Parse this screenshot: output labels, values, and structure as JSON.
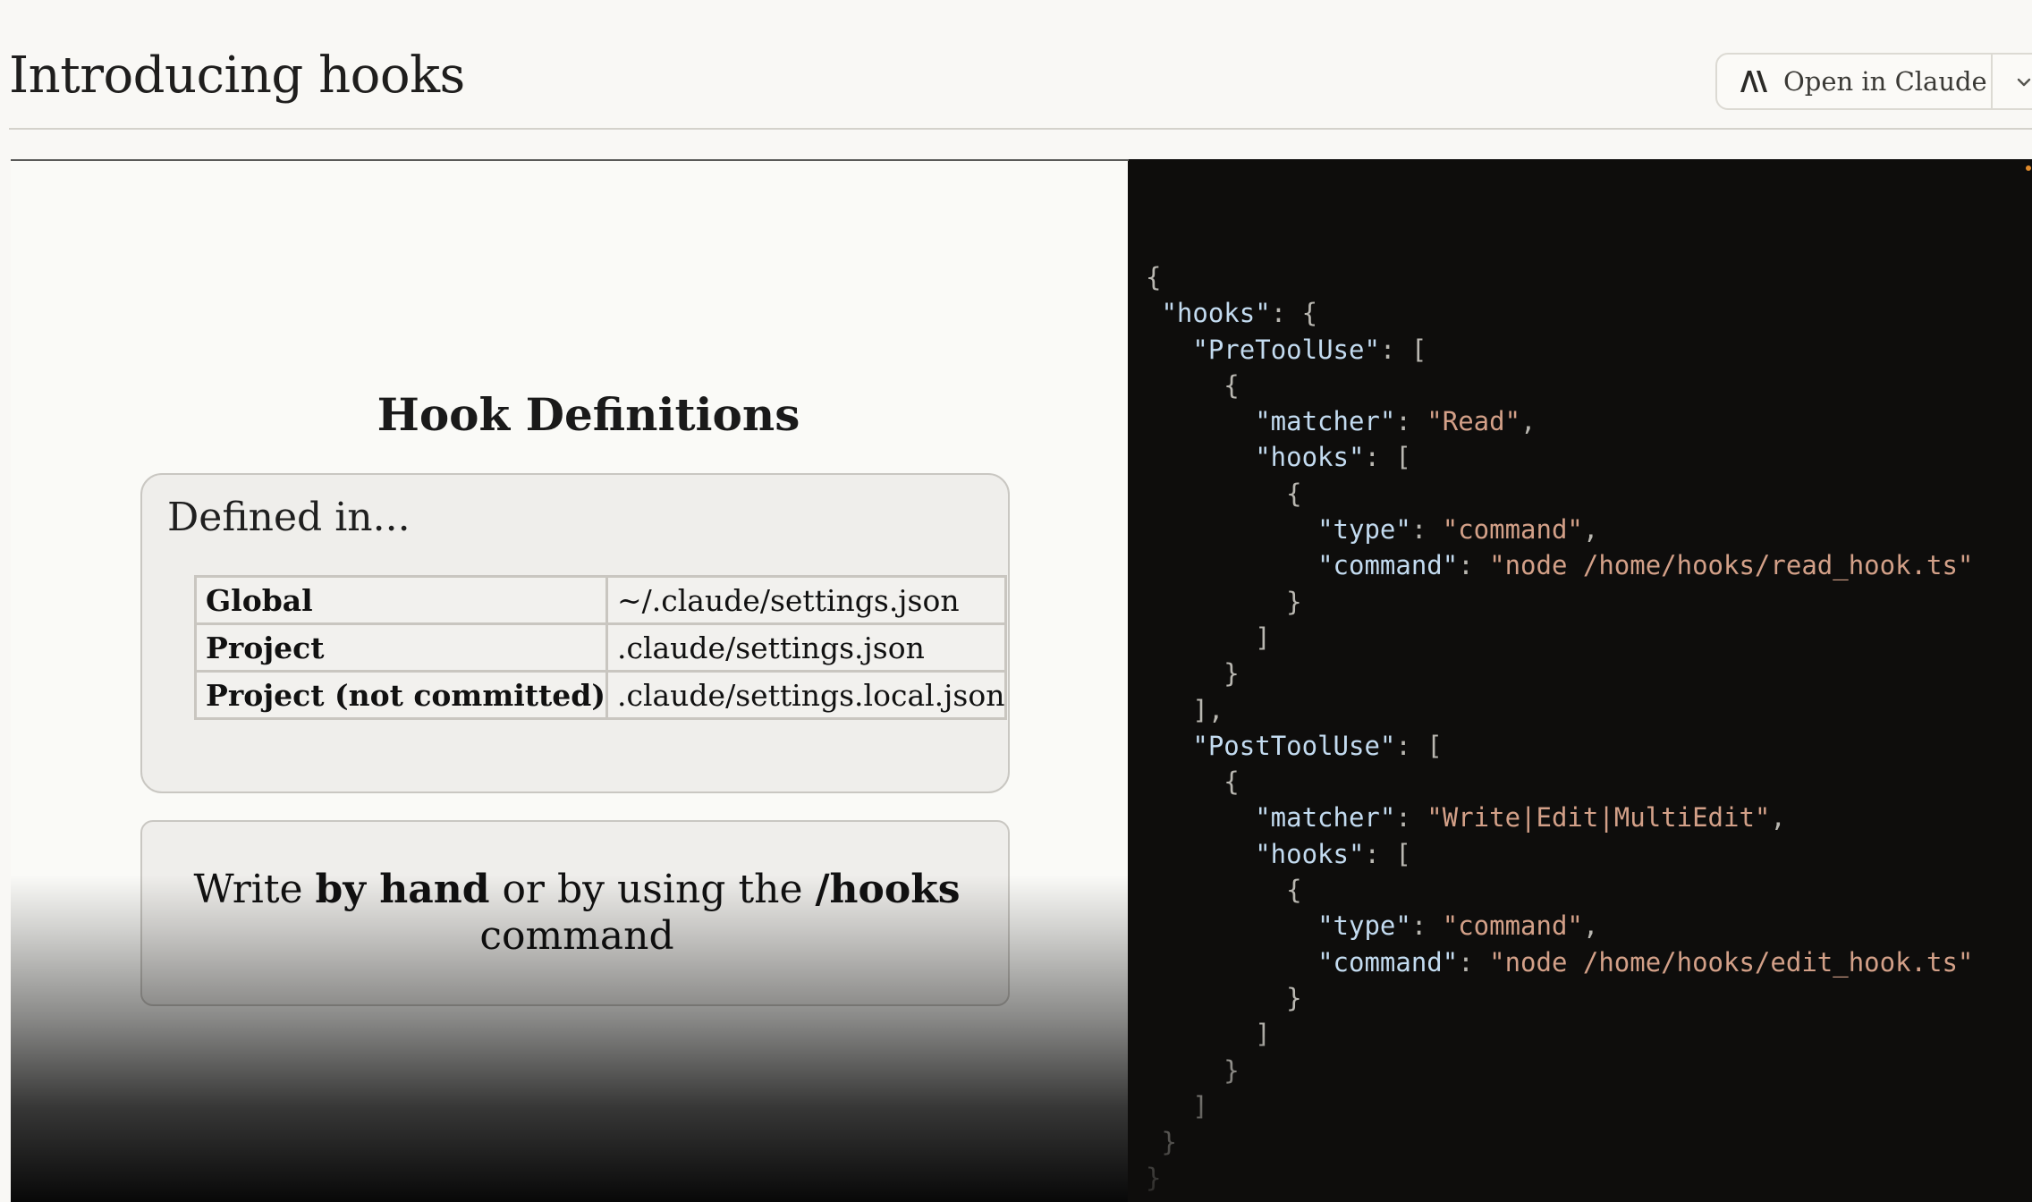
{
  "header": {
    "title": "Introducing hooks",
    "open_button_label": "Open in Claude"
  },
  "slide": {
    "title": "Hook Definitions",
    "defined_label": "Defined in...",
    "table": [
      {
        "scope": "Global",
        "path": "~/.claude/settings.json"
      },
      {
        "scope": "Project",
        "path": ".claude/settings.json"
      },
      {
        "scope": "Project (not committed)",
        "path": ".claude/settings.local.json"
      }
    ],
    "write": {
      "prefix": "Write ",
      "bold1": "by hand",
      "middle": " or by using the ",
      "bold2": "/hooks",
      "suffix": "command"
    }
  },
  "code": {
    "lines": [
      [
        [
          "p",
          "{"
        ]
      ],
      [
        [
          "p",
          " "
        ],
        [
          "k",
          "\"hooks\""
        ],
        [
          "p",
          ": {"
        ]
      ],
      [
        [
          "p",
          "   "
        ],
        [
          "k",
          "\"PreToolUse\""
        ],
        [
          "p",
          ": ["
        ]
      ],
      [
        [
          "p",
          "     {"
        ]
      ],
      [
        [
          "p",
          "       "
        ],
        [
          "k",
          "\"matcher\""
        ],
        [
          "p",
          ": "
        ],
        [
          "s",
          "\"Read\""
        ],
        [
          "p",
          ","
        ]
      ],
      [
        [
          "p",
          "       "
        ],
        [
          "k",
          "\"hooks\""
        ],
        [
          "p",
          ": ["
        ]
      ],
      [
        [
          "p",
          "         {"
        ]
      ],
      [
        [
          "p",
          "           "
        ],
        [
          "k",
          "\"type\""
        ],
        [
          "p",
          ": "
        ],
        [
          "s",
          "\"command\""
        ],
        [
          "p",
          ","
        ]
      ],
      [
        [
          "p",
          "           "
        ],
        [
          "k",
          "\"command\""
        ],
        [
          "p",
          ": "
        ],
        [
          "s",
          "\"node /home/hooks/read_hook.ts\""
        ]
      ],
      [
        [
          "p",
          "         }"
        ]
      ],
      [
        [
          "p",
          "       ]"
        ]
      ],
      [
        [
          "p",
          "     }"
        ]
      ],
      [
        [
          "p",
          "   ],"
        ]
      ],
      [
        [
          "p",
          "   "
        ],
        [
          "k",
          "\"PostToolUse\""
        ],
        [
          "p",
          ": ["
        ]
      ],
      [
        [
          "p",
          "     {"
        ]
      ],
      [
        [
          "p",
          "       "
        ],
        [
          "k",
          "\"matcher\""
        ],
        [
          "p",
          ": "
        ],
        [
          "s",
          "\"Write|Edit|MultiEdit\""
        ],
        [
          "p",
          ","
        ]
      ],
      [
        [
          "p",
          "       "
        ],
        [
          "k",
          "\"hooks\""
        ],
        [
          "p",
          ": ["
        ]
      ],
      [
        [
          "p",
          "         {"
        ]
      ],
      [
        [
          "p",
          "           "
        ],
        [
          "k",
          "\"type\""
        ],
        [
          "p",
          ": "
        ],
        [
          "s",
          "\"command\""
        ],
        [
          "p",
          ","
        ]
      ],
      [
        [
          "p",
          "           "
        ],
        [
          "k",
          "\"command\""
        ],
        [
          "p",
          ": "
        ],
        [
          "s",
          "\"node /home/hooks/edit_hook.ts\""
        ]
      ],
      [
        [
          "p",
          "         }"
        ]
      ],
      [
        [
          "p",
          "       ]"
        ]
      ],
      [
        [
          "p",
          "     }"
        ]
      ],
      [
        [
          "p",
          "   ]"
        ]
      ],
      [
        [
          "p",
          " }"
        ]
      ],
      [
        [
          "p",
          "}"
        ]
      ]
    ]
  },
  "icons": {
    "logo": "claude-logo-icon",
    "dropdown": "chevron-down-icon"
  },
  "colors": {
    "code_background": "#0e0d0c",
    "code_key": "#c3dbf0",
    "code_string": "#d3a088",
    "code_punctuation": "#b9b7b1",
    "page_background": "#f9f8f5"
  }
}
